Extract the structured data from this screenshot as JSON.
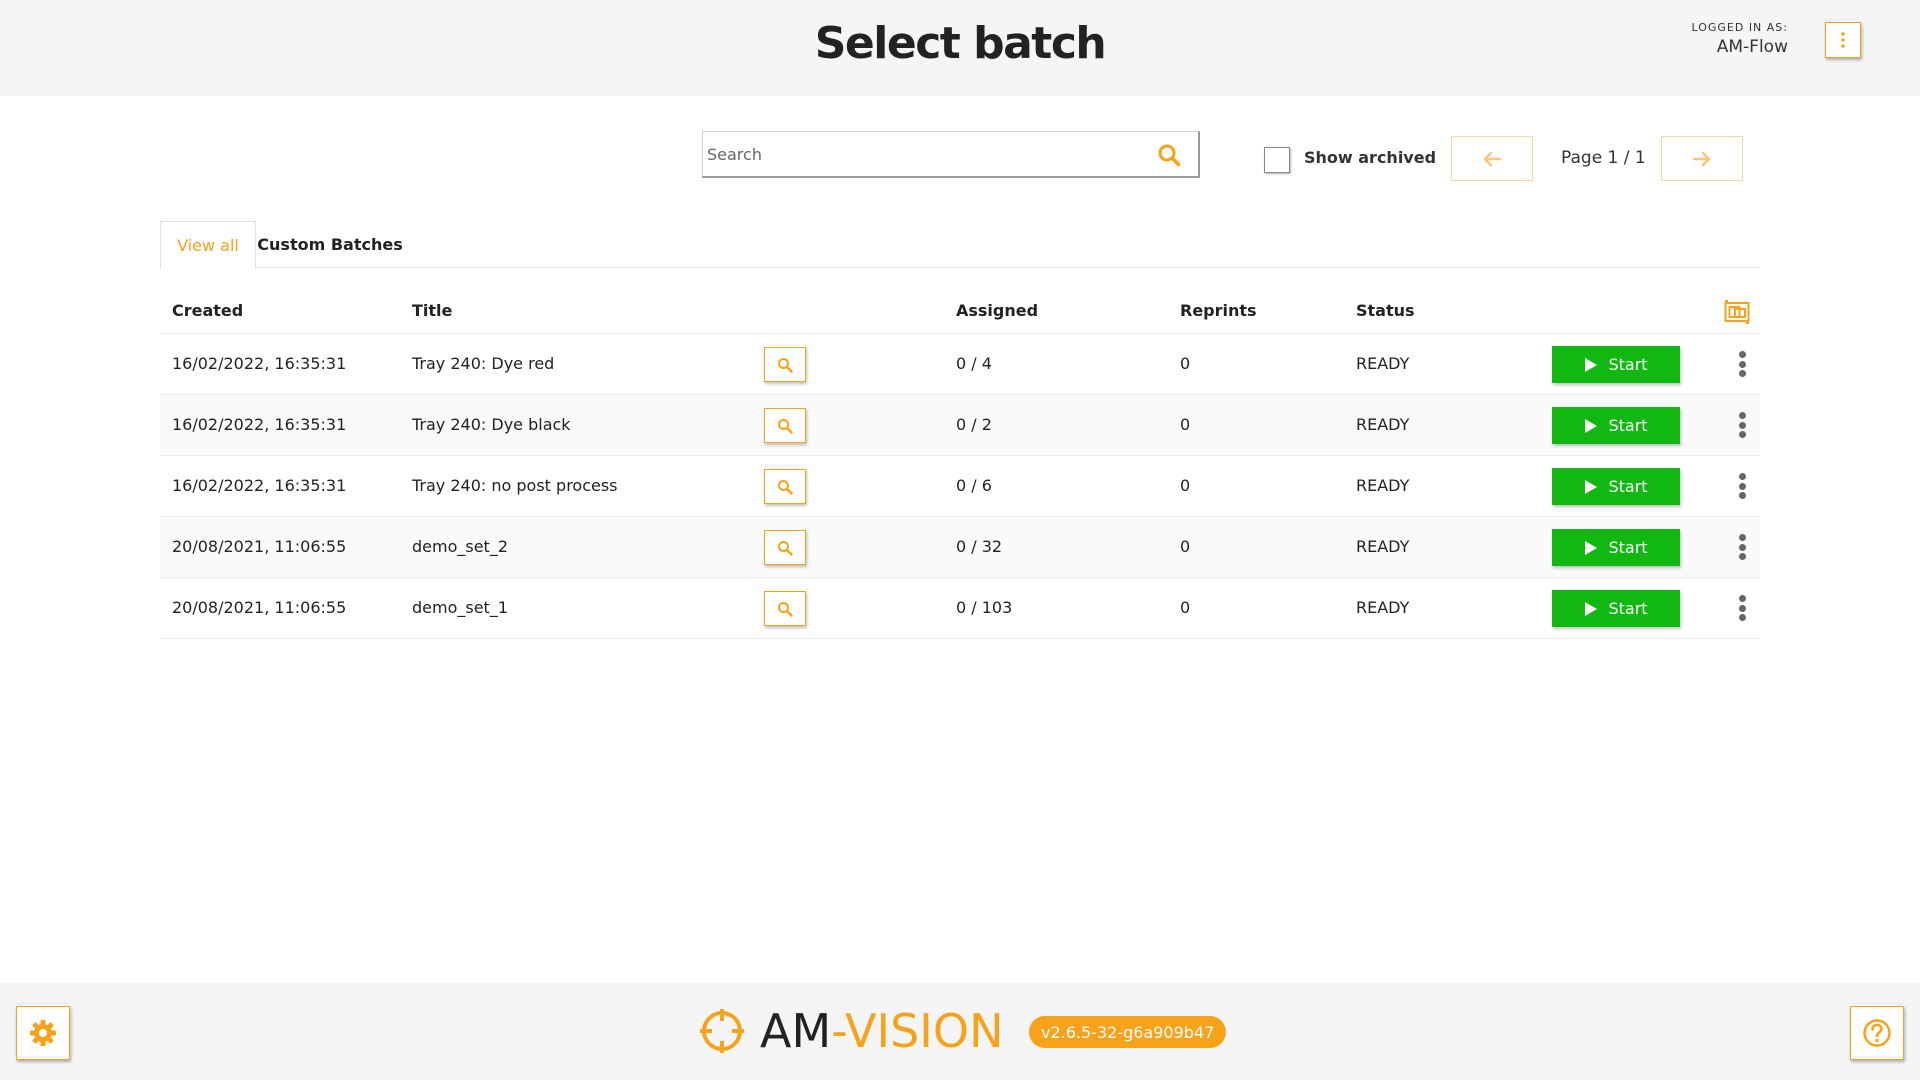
{
  "header": {
    "title": "Select batch",
    "logged_in_label": "LOGGED IN AS:",
    "user": "AM-Flow"
  },
  "toolbar": {
    "search_placeholder": "Search",
    "search_value": "",
    "show_archived_label": "Show archived",
    "show_archived_checked": false,
    "page_indicator": "Page 1 / 1"
  },
  "tabs": [
    {
      "label": "View all",
      "active": true
    },
    {
      "label": "Custom Batches",
      "active": false
    }
  ],
  "table": {
    "columns": {
      "created": "Created",
      "title": "Title",
      "assigned": "Assigned",
      "reprints": "Reprints",
      "status": "Status"
    },
    "start_label": "Start",
    "rows": [
      {
        "created": "16/02/2022, 16:35:31",
        "title": "Tray 240: Dye red",
        "assigned": "0 / 4",
        "reprints": "0",
        "status": "READY"
      },
      {
        "created": "16/02/2022, 16:35:31",
        "title": "Tray 240: Dye black",
        "assigned": "0 / 2",
        "reprints": "0",
        "status": "READY"
      },
      {
        "created": "16/02/2022, 16:35:31",
        "title": "Tray 240: no post process",
        "assigned": "0 / 6",
        "reprints": "0",
        "status": "READY"
      },
      {
        "created": "20/08/2021, 11:06:55",
        "title": "demo_set_2",
        "assigned": "0 / 32",
        "reprints": "0",
        "status": "READY"
      },
      {
        "created": "20/08/2021, 11:06:55",
        "title": "demo_set_1",
        "assigned": "0 / 103",
        "reprints": "0",
        "status": "READY"
      }
    ]
  },
  "footer": {
    "brand_am": "AM",
    "brand_vision": "-VISION",
    "version": "v2.6.5-32-g6a909b47"
  },
  "icons": {
    "header_menu": "vertical-dots-icon",
    "search": "search-icon",
    "prev": "arrow-left-icon",
    "next": "arrow-right-icon",
    "columns": "column-settings-icon",
    "row_view": "search-icon",
    "start": "play-icon",
    "row_menu": "vertical-dots-icon",
    "settings": "gear-icon",
    "help": "help-icon",
    "logo": "crosshair-logo-icon"
  },
  "colors": {
    "accent": "#f7a21b",
    "start_green": "#12b812",
    "header_bg": "#f5f5f5"
  }
}
